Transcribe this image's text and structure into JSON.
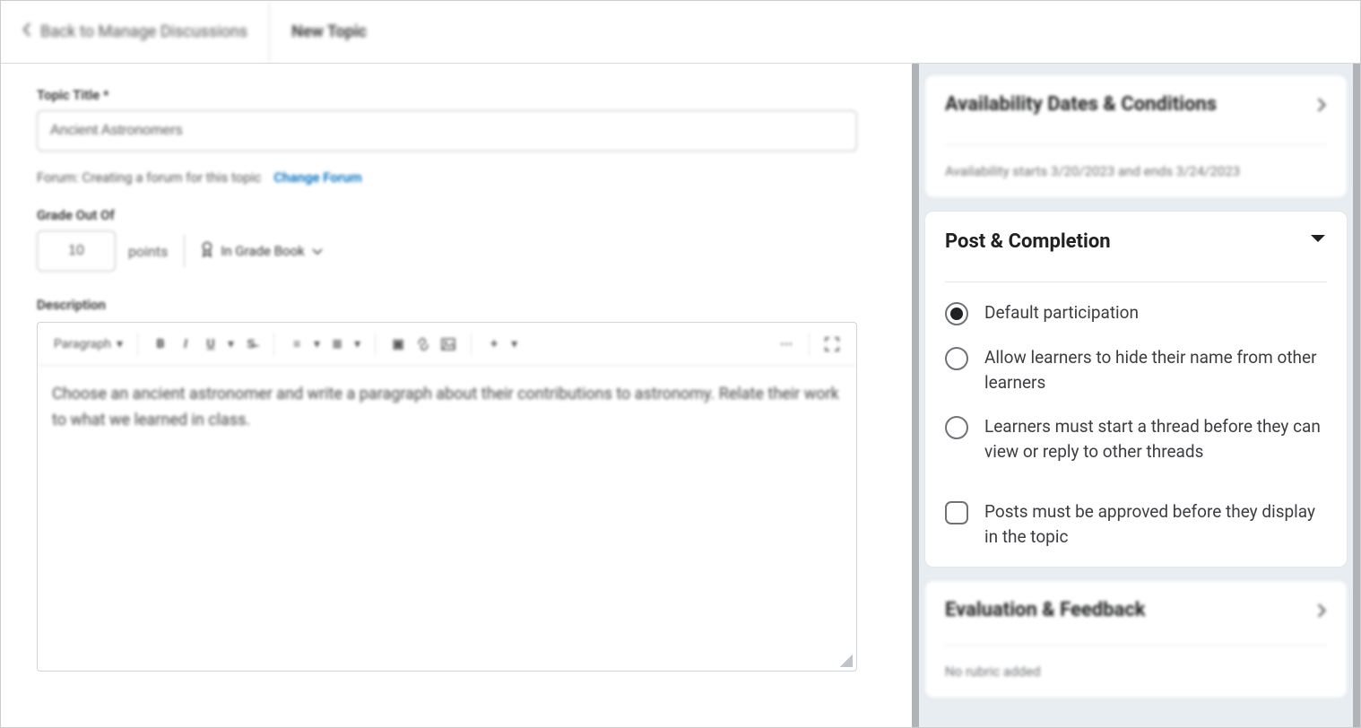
{
  "topbar": {
    "back": "Back to Manage Discussions",
    "title": "New Topic"
  },
  "main": {
    "topic_title_label": "Topic Title *",
    "topic_title_value": "Ancient Astronomers",
    "forum_text": "Forum: Creating a forum for this topic",
    "change_forum": "Change Forum",
    "grade_label": "Grade Out Of",
    "grade_value": "10",
    "points_label": "points",
    "gradebook_label": "In Grade Book",
    "description_label": "Description",
    "toolbar_paragraph": "Paragraph",
    "description_body": "Choose an ancient astronomer and write a paragraph about their contributions to astronomy. Relate their work to what we learned in class."
  },
  "side": {
    "availability": {
      "title": "Availability Dates & Conditions",
      "summary": "Availability starts 3/20/2023 and ends 3/24/2023"
    },
    "post": {
      "title": "Post & Completion",
      "opt1": "Default participation",
      "opt2": "Allow learners to hide their name from other learners",
      "opt3": "Learners must start a thread before they can view or reply to other threads",
      "check1": "Posts must be approved before they display in the topic"
    },
    "eval": {
      "title": "Evaluation & Feedback",
      "summary": "No rubric added"
    }
  }
}
